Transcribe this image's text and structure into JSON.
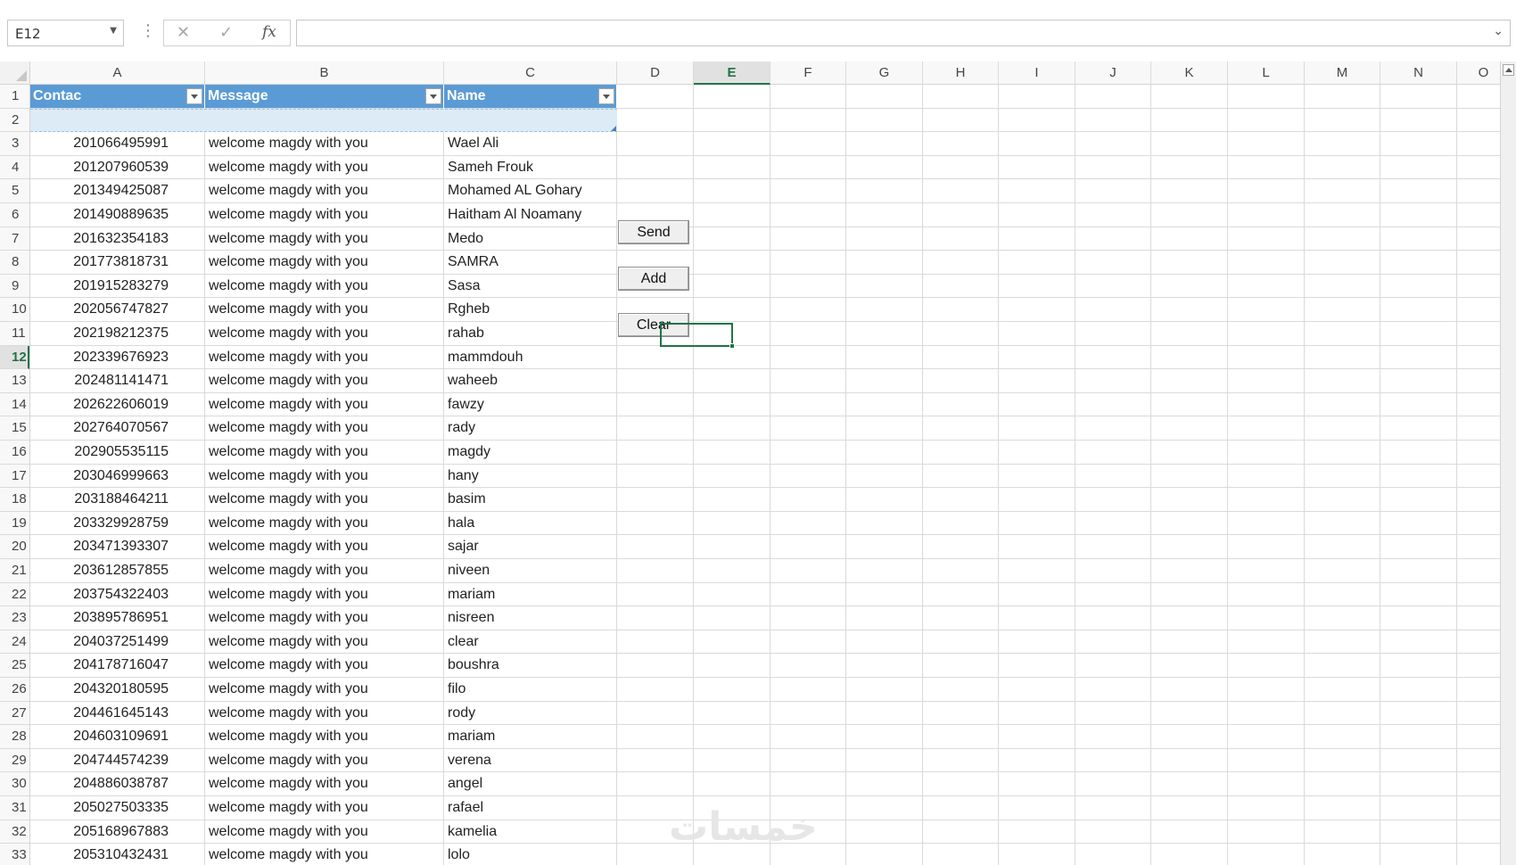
{
  "formula_bar": {
    "name_box": "E12",
    "formula_value": ""
  },
  "columns": [
    "A",
    "B",
    "C",
    "D",
    "E",
    "F",
    "G",
    "H",
    "I",
    "J",
    "K",
    "L",
    "M",
    "N",
    "O"
  ],
  "selected_column": "E",
  "selected_row": "12",
  "row_numbers": [
    "1",
    "2",
    "3",
    "4",
    "5",
    "6",
    "7",
    "8",
    "9",
    "10",
    "11",
    "12",
    "13",
    "14",
    "15",
    "16",
    "17",
    "18",
    "19",
    "20",
    "21",
    "22",
    "23",
    "24",
    "25",
    "26",
    "27",
    "28",
    "29",
    "30",
    "31",
    "32",
    "33"
  ],
  "table": {
    "headers": [
      "Contac",
      "Message",
      "Name"
    ],
    "rows": [
      [
        "201066495991",
        "welcome magdy with you",
        "Wael Ali"
      ],
      [
        "201207960539",
        "welcome magdy with you",
        "Sameh Frouk"
      ],
      [
        "201349425087",
        "welcome magdy with you",
        "Mohamed AL Gohary"
      ],
      [
        "201490889635",
        "welcome magdy with you",
        "Haitham Al Noamany"
      ],
      [
        "201632354183",
        "welcome magdy with you",
        "Medo"
      ],
      [
        "201773818731",
        "welcome magdy with you",
        "SAMRA"
      ],
      [
        "201915283279",
        "welcome magdy with you",
        "Sasa"
      ],
      [
        "202056747827",
        "welcome magdy with you",
        "Rgheb"
      ],
      [
        "202198212375",
        "welcome magdy with you",
        "rahab"
      ],
      [
        "202339676923",
        "welcome magdy with you",
        "mammdouh"
      ],
      [
        "202481141471",
        "welcome magdy with you",
        "waheeb"
      ],
      [
        "202622606019",
        "welcome magdy with you",
        "fawzy"
      ],
      [
        "202764070567",
        "welcome magdy with you",
        "rady"
      ],
      [
        "202905535115",
        "welcome magdy with you",
        "magdy"
      ],
      [
        "203046999663",
        "welcome magdy with you",
        "hany"
      ],
      [
        "203188464211",
        "welcome magdy with you",
        "basim"
      ],
      [
        "203329928759",
        "welcome magdy with you",
        "hala"
      ],
      [
        "203471393307",
        "welcome magdy with you",
        "sajar"
      ],
      [
        "203612857855",
        "welcome magdy with you",
        "niveen"
      ],
      [
        "203754322403",
        "welcome magdy with you",
        "mariam"
      ],
      [
        "203895786951",
        "welcome magdy with you",
        "nisreen"
      ],
      [
        "204037251499",
        "welcome magdy with you",
        "clear"
      ],
      [
        "204178716047",
        "welcome magdy with you",
        "boushra"
      ],
      [
        "204320180595",
        "welcome magdy with you",
        "filo"
      ],
      [
        "204461645143",
        "welcome magdy with you",
        "rody"
      ],
      [
        "204603109691",
        "welcome magdy with you",
        "mariam"
      ],
      [
        "204744574239",
        "welcome magdy with you",
        "verena"
      ],
      [
        "204886038787",
        "welcome magdy with you",
        "angel"
      ],
      [
        "205027503335",
        "welcome magdy with you",
        "rafael"
      ],
      [
        "205168967883",
        "welcome magdy with you",
        "kamelia"
      ],
      [
        "205310432431",
        "welcome magdy with you",
        "lolo"
      ]
    ]
  },
  "buttons": {
    "send": "Send",
    "add": "Add",
    "clear": "Clear"
  },
  "watermark": "خمسات",
  "colors": {
    "table_header": "#5b9bd5",
    "selection": "#217346"
  }
}
